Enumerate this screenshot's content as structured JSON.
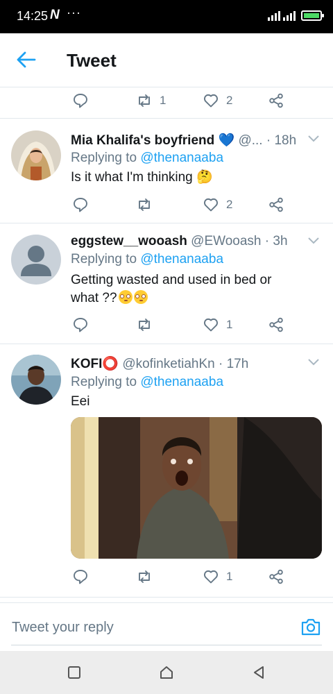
{
  "status_bar": {
    "time": "14:25",
    "app_badge": "N",
    "dots": "···"
  },
  "app_bar": {
    "title": "Tweet"
  },
  "top_actions": {
    "retweets": "1",
    "likes": "2"
  },
  "tweets": [
    {
      "name": "Mia Khalifa's boyfriend 💙",
      "handle": "@...",
      "time": "· 18h",
      "replying_prefix": "Replying to ",
      "replying_to": "@thenanaaba",
      "text": "Is it what I'm thinking 🤔",
      "retweets": "",
      "likes": "2"
    },
    {
      "name": "eggstew__wooash",
      "handle": "@EWooash",
      "time": "· 3h",
      "replying_prefix": "Replying to ",
      "replying_to": "@thenanaaba",
      "text": "Getting wasted and used in bed or what ??",
      "retweets": "",
      "likes": "1"
    },
    {
      "name": "KOFI⭕",
      "handle": "@kofinketiahKn",
      "time": "· 17h",
      "replying_prefix": "Replying to ",
      "replying_to": "@thenanaaba",
      "text": "Eei",
      "retweets": "",
      "likes": "1"
    }
  ],
  "composer": {
    "placeholder": "Tweet your reply"
  },
  "icons": {
    "back": "arrow-left-icon",
    "reply": "reply-icon",
    "retweet": "retweet-icon",
    "like": "heart-icon",
    "share": "share-icon",
    "camera": "camera-icon",
    "chevron": "chevron-down-icon"
  },
  "colors": {
    "accent": "#1da1f2",
    "muted": "#657786",
    "text": "#14171a",
    "divider": "#e1e8ed"
  }
}
